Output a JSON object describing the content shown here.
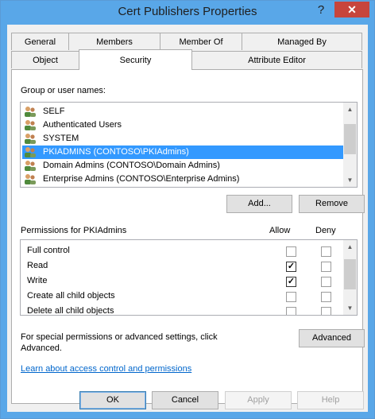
{
  "window": {
    "title": "Cert Publishers Properties",
    "help_glyph": "?",
    "close_glyph": "✕"
  },
  "tabs_row1": [
    {
      "label": "General"
    },
    {
      "label": "Members"
    },
    {
      "label": "Member Of"
    },
    {
      "label": "Managed By"
    }
  ],
  "tabs_row2": [
    {
      "label": "Object"
    },
    {
      "label": "Security"
    },
    {
      "label": "Attribute Editor"
    }
  ],
  "security": {
    "group_label": "Group or user names:",
    "users": [
      {
        "name": "SELF"
      },
      {
        "name": "Authenticated Users"
      },
      {
        "name": "SYSTEM"
      },
      {
        "name": "PKIADMINS (CONTOSO\\PKIAdmins)"
      },
      {
        "name": "Domain Admins (CONTOSO\\Domain Admins)"
      },
      {
        "name": "Enterprise Admins (CONTOSO\\Enterprise Admins)"
      }
    ],
    "selected_user_index": 3,
    "add_label": "Add...",
    "remove_label": "Remove",
    "permissions_label": "Permissions for PKIAdmins",
    "allow_header": "Allow",
    "deny_header": "Deny",
    "permissions": [
      {
        "name": "Full control",
        "allow": false,
        "deny": false
      },
      {
        "name": "Read",
        "allow": true,
        "deny": false
      },
      {
        "name": "Write",
        "allow": true,
        "deny": false
      },
      {
        "name": "Create all child objects",
        "allow": false,
        "deny": false
      },
      {
        "name": "Delete all child objects",
        "allow": false,
        "deny": false
      }
    ],
    "special_text_line1": "For special permissions or advanced settings, click",
    "special_text_line2": "Advanced.",
    "advanced_label": "Advanced",
    "learn_link": "Learn about access control and permissions"
  },
  "footer": {
    "ok": "OK",
    "cancel": "Cancel",
    "apply": "Apply",
    "help": "Help"
  },
  "colors": {
    "titlebar": "#59a7e8",
    "selection": "#3399ff",
    "close": "#c7453c",
    "link": "#0066cc"
  },
  "check_glyph": "✓",
  "arrow_up": "▲",
  "arrow_down": "▼"
}
